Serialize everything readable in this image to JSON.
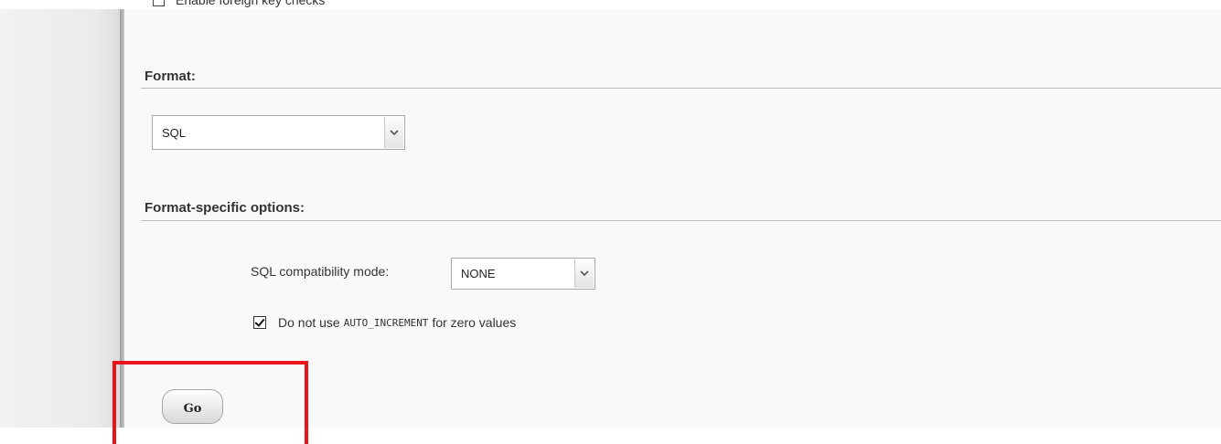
{
  "top_option": {
    "label": "Enable foreign key checks"
  },
  "format_section": {
    "title": "Format:",
    "selected": "SQL"
  },
  "options_section": {
    "title": "Format-specific options:",
    "compat_label": "SQL compatibility mode:",
    "compat_selected": "NONE",
    "zero_checkbox": {
      "checked": true,
      "prefix": "Do not use",
      "code": "AUTO_INCREMENT",
      "suffix": "for zero values"
    }
  },
  "actions": {
    "go_label": "Go"
  },
  "colors": {
    "highlight": "#e8141a",
    "panel_bg": "#f9f9f9"
  },
  "icons": {
    "select_arrow": "chevron-down-icon",
    "check": "checkmark-icon"
  }
}
